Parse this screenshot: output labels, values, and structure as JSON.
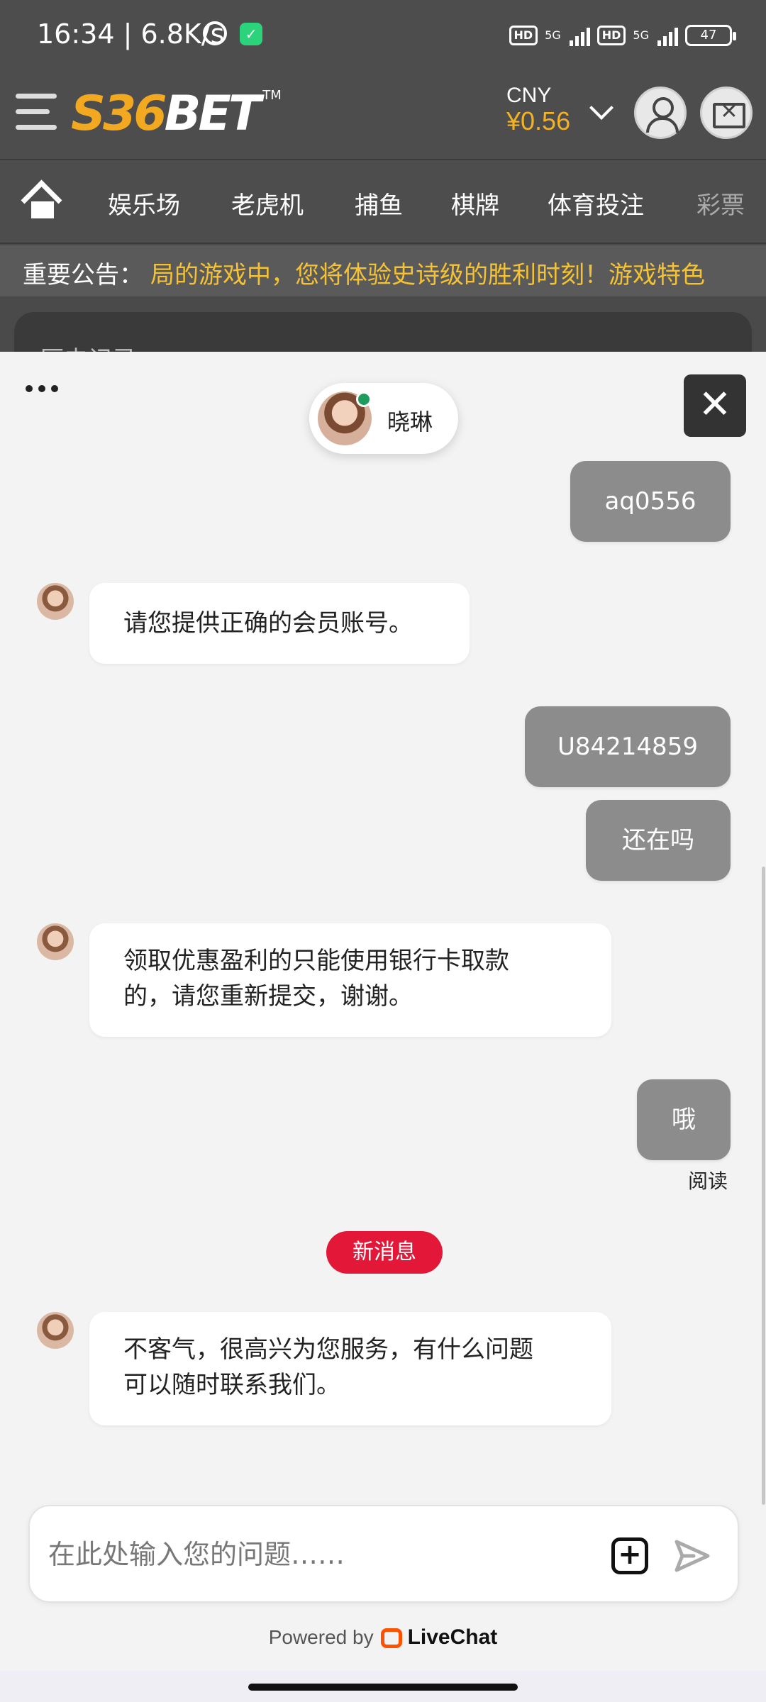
{
  "status_bar": {
    "time": "16:34 | 6.8K/s",
    "hd1": "HD",
    "net1": "5G",
    "hd2": "HD",
    "net2": "5G",
    "battery": "47"
  },
  "header": {
    "logo_left": "S36",
    "logo_right": "BET",
    "logo_tm": "TM",
    "currency_code": "CNY",
    "balance": "¥0.56"
  },
  "nav": {
    "items": [
      "娱乐场",
      "老虎机",
      "捕鱼",
      "棋牌",
      "体育投注",
      "彩票"
    ]
  },
  "announcement": {
    "label": "重要公告：",
    "text": "局的游戏中，您将体验史诗级的胜利时刻！游戏特色"
  },
  "history": {
    "title": "历史记录"
  },
  "chat": {
    "agent_name": "晓琳",
    "messages": [
      {
        "from": "me",
        "text": "aq0556"
      },
      {
        "from": "agent",
        "text": "请您提供正确的会员账号。"
      },
      {
        "from": "me",
        "text": "U84214859"
      },
      {
        "from": "me",
        "text": "还在吗"
      },
      {
        "from": "agent",
        "line1": "领取优惠盈利的只能使用银行卡取款",
        "line2": "的，请您重新提交，谢谢。"
      },
      {
        "from": "me",
        "text": "哦"
      },
      {
        "from": "agent",
        "line1": "不客气，很高兴为您服务，有什么问题",
        "line2": "可以随时联系我们。"
      }
    ],
    "read_status": "阅读",
    "new_messages": "新消息",
    "input_placeholder": "在此处输入您的问题……",
    "powered_by": "Powered by",
    "brand": "LiveChat"
  },
  "colors": {
    "accent_gold": "#f4b223",
    "new_badge": "#e31838",
    "my_bubble": "#8c8c8c",
    "online": "#1e9c5c",
    "livechat_orange": "#ff5100"
  }
}
